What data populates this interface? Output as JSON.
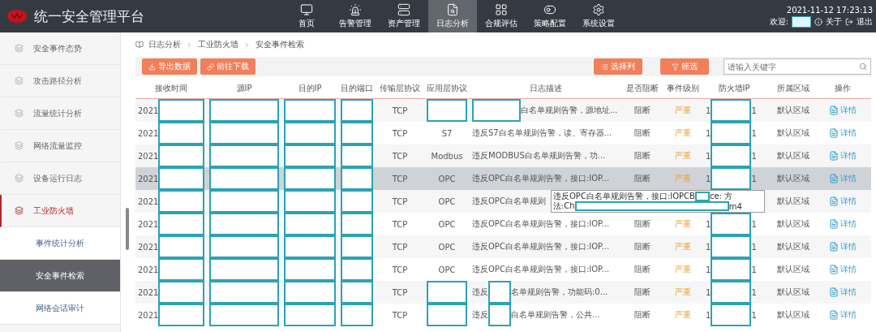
{
  "header": {
    "title": "统一安全管理平台",
    "nav": [
      {
        "label": "首页",
        "selected": false
      },
      {
        "label": "告警管理",
        "selected": false
      },
      {
        "label": "资产管理",
        "selected": false
      },
      {
        "label": "日志分析",
        "selected": true
      },
      {
        "label": "合规评估",
        "selected": false
      },
      {
        "label": "策略配置",
        "selected": false
      },
      {
        "label": "系统设置",
        "selected": false
      }
    ],
    "datetime": "2021-11-12 17:23:13",
    "welcome": "欢迎:",
    "about": "关于",
    "logout": "退出"
  },
  "sidebar": {
    "items": [
      {
        "label": "安全事件态势",
        "selected": false
      },
      {
        "label": "攻击路径分析",
        "selected": false
      },
      {
        "label": "流量统计分析",
        "selected": false
      },
      {
        "label": "网络流量监控",
        "selected": false
      },
      {
        "label": "设备运行日志",
        "selected": false
      },
      {
        "label": "工业防火墙",
        "selected": true,
        "children": [
          {
            "label": "事件统计分析",
            "selected": false
          },
          {
            "label": "安全事件检索",
            "selected": true
          },
          {
            "label": "网络会话审计",
            "selected": false
          }
        ]
      }
    ]
  },
  "breadcrumb": [
    "日志分析",
    "工业防火墙",
    "安全事件检索"
  ],
  "toolbar": {
    "left_buttons": [
      "导出数据",
      "前往下载"
    ],
    "right_buttons": [
      "选择列",
      "筛选"
    ],
    "search": {
      "placeholder": "请输入关键字"
    }
  },
  "table": {
    "columns": [
      "接收时间",
      "源IP",
      "目的IP",
      "目的端口",
      "传输层协议",
      "应用层协议",
      "日志描述",
      "是否阻断",
      "事件级别",
      "防火墙IP",
      "所属区域",
      "操作"
    ],
    "rows": [
      {
        "highlighted": false,
        "cells": [
          {
            "text": "2021",
            "redacted": true
          },
          {
            "redacted": true
          },
          {
            "redacted": true
          },
          {
            "redacted": true
          },
          {
            "text": "TCP"
          },
          {
            "redacted": true
          },
          {
            "text": "白名单规则告警，源地址...",
            "redacted_start": true
          },
          {
            "text": "阻断"
          },
          {
            "text": "严重"
          },
          {
            "text": "1",
            "redacted": true,
            "tail": "1"
          },
          {
            "text": "默认区域"
          },
          {
            "text": "详情"
          }
        ]
      },
      {
        "highlighted": false,
        "cells": [
          {
            "text": "2021",
            "redacted": true
          },
          {
            "redacted": true
          },
          {
            "redacted": true
          },
          {
            "redacted": true
          },
          {
            "text": "TCP"
          },
          {
            "text": "S7"
          },
          {
            "text": "违反S7白名单规则告警，读、寄存器..."
          },
          {
            "text": "阻断"
          },
          {
            "text": "严重"
          },
          {
            "text": "1",
            "redacted": true,
            "tail": "1"
          },
          {
            "text": "默认区域"
          },
          {
            "text": "详情"
          }
        ]
      },
      {
        "highlighted": false,
        "cells": [
          {
            "text": "2021",
            "redacted": true
          },
          {
            "redacted": true
          },
          {
            "redacted": true
          },
          {
            "redacted": true
          },
          {
            "text": "TCP"
          },
          {
            "text": "Modbus"
          },
          {
            "text": "违反MODBUS白名单规则告警，功..."
          },
          {
            "text": "阻断"
          },
          {
            "text": "严重"
          },
          {
            "text": "1",
            "redacted": true,
            "tail": "1"
          },
          {
            "text": "默认区域"
          },
          {
            "text": "详情"
          }
        ]
      },
      {
        "highlighted": true,
        "cells": [
          {
            "text": "2021",
            "redacted": true
          },
          {
            "redacted": true
          },
          {
            "redacted": true
          },
          {
            "redacted": true
          },
          {
            "text": "TCP"
          },
          {
            "text": "OPC"
          },
          {
            "text": "违反OPC白名单规则告警，接口:IOP..."
          },
          {
            "text": "阻断"
          },
          {
            "text": "严重"
          },
          {
            "text": "1",
            "redacted": true,
            "tail": "1"
          },
          {
            "text": "默认区域"
          },
          {
            "text": "详情"
          }
        ]
      },
      {
        "highlighted": false,
        "tooltip": {
          "lines": [
            {
              "text": "违反OPC白名单规则告警，接口:IOPCB",
              "tail": "ce: 方"
            },
            {
              "text": "法:Ch",
              "tail": "m4"
            }
          ]
        },
        "cells": [
          {
            "text": "2021",
            "redacted": true
          },
          {
            "redacted": true
          },
          {
            "redacted": true
          },
          {
            "redacted": true
          },
          {
            "text": "TCP"
          },
          {
            "text": "OPC"
          },
          {
            "text": "违反OPC白名单规则"
          },
          {},
          {},
          {},
          {
            "text": "默认区域"
          },
          {
            "text": "详情"
          }
        ]
      },
      {
        "highlighted": false,
        "cells": [
          {
            "text": "2021",
            "redacted": true
          },
          {
            "redacted": true
          },
          {
            "redacted": true
          },
          {
            "redacted": true
          },
          {
            "text": "TCP"
          },
          {
            "text": "OPC"
          },
          {
            "text": "违反OPC白名单规则告警，接口:IOP..."
          },
          {
            "text": "阻断"
          },
          {
            "text": "严重"
          },
          {
            "text": "1",
            "redacted": true,
            "tail": "1"
          },
          {
            "text": "默认区域"
          },
          {
            "text": "详情"
          }
        ]
      },
      {
        "highlighted": false,
        "cells": [
          {
            "text": "2021",
            "redacted": true
          },
          {
            "redacted": true
          },
          {
            "redacted": true
          },
          {
            "redacted": true
          },
          {
            "text": "TCP"
          },
          {
            "text": "OPC"
          },
          {
            "text": "违反OPC白名单规则告警，接口:IOP..."
          },
          {
            "text": "阻断"
          },
          {
            "text": "严重"
          },
          {
            "text": "1",
            "redacted": true,
            "tail": "1"
          },
          {
            "text": "默认区域"
          },
          {
            "text": "详情"
          }
        ]
      },
      {
        "highlighted": false,
        "cells": [
          {
            "text": "2021",
            "redacted": true
          },
          {
            "redacted": true
          },
          {
            "redacted": true
          },
          {
            "redacted": true
          },
          {
            "text": "TCP"
          },
          {
            "text": "OPC"
          },
          {
            "text": "违反OPC白名单规则告警，接口:IOP..."
          },
          {
            "text": "阻断"
          },
          {
            "text": "严重"
          },
          {
            "text": "1",
            "redacted": true,
            "tail": "1"
          },
          {
            "text": "默认区域"
          },
          {
            "text": "详情"
          }
        ]
      },
      {
        "highlighted": false,
        "cells": [
          {
            "text": "2021",
            "redacted": true
          },
          {
            "redacted": true
          },
          {
            "redacted": true
          },
          {
            "redacted": true
          },
          {
            "text": "TCP"
          },
          {
            "redacted": true
          },
          {
            "text": "违反",
            "redacted": true,
            "tail": "名单规则告警，功能码:0..."
          },
          {
            "text": "阻断"
          },
          {
            "text": "严重"
          },
          {
            "text": "1",
            "redacted": true,
            "tail": "1"
          },
          {
            "text": "默认区域"
          },
          {
            "text": "详情"
          }
        ]
      },
      {
        "highlighted": false,
        "cells": [
          {
            "text": "2021",
            "redacted": true
          },
          {
            "redacted": true
          },
          {
            "redacted": true
          },
          {
            "redacted": true
          },
          {
            "text": "TCP"
          },
          {
            "redacted": true
          },
          {
            "text": "违反",
            "redacted": true,
            "tail": "白名单规则告警，公共..."
          },
          {
            "text": "阻断"
          },
          {
            "text": "严重"
          },
          {
            "text": "1",
            "redacted": true,
            "tail": "1"
          },
          {
            "text": "默认区域"
          },
          {
            "text": "详情"
          }
        ]
      }
    ]
  }
}
